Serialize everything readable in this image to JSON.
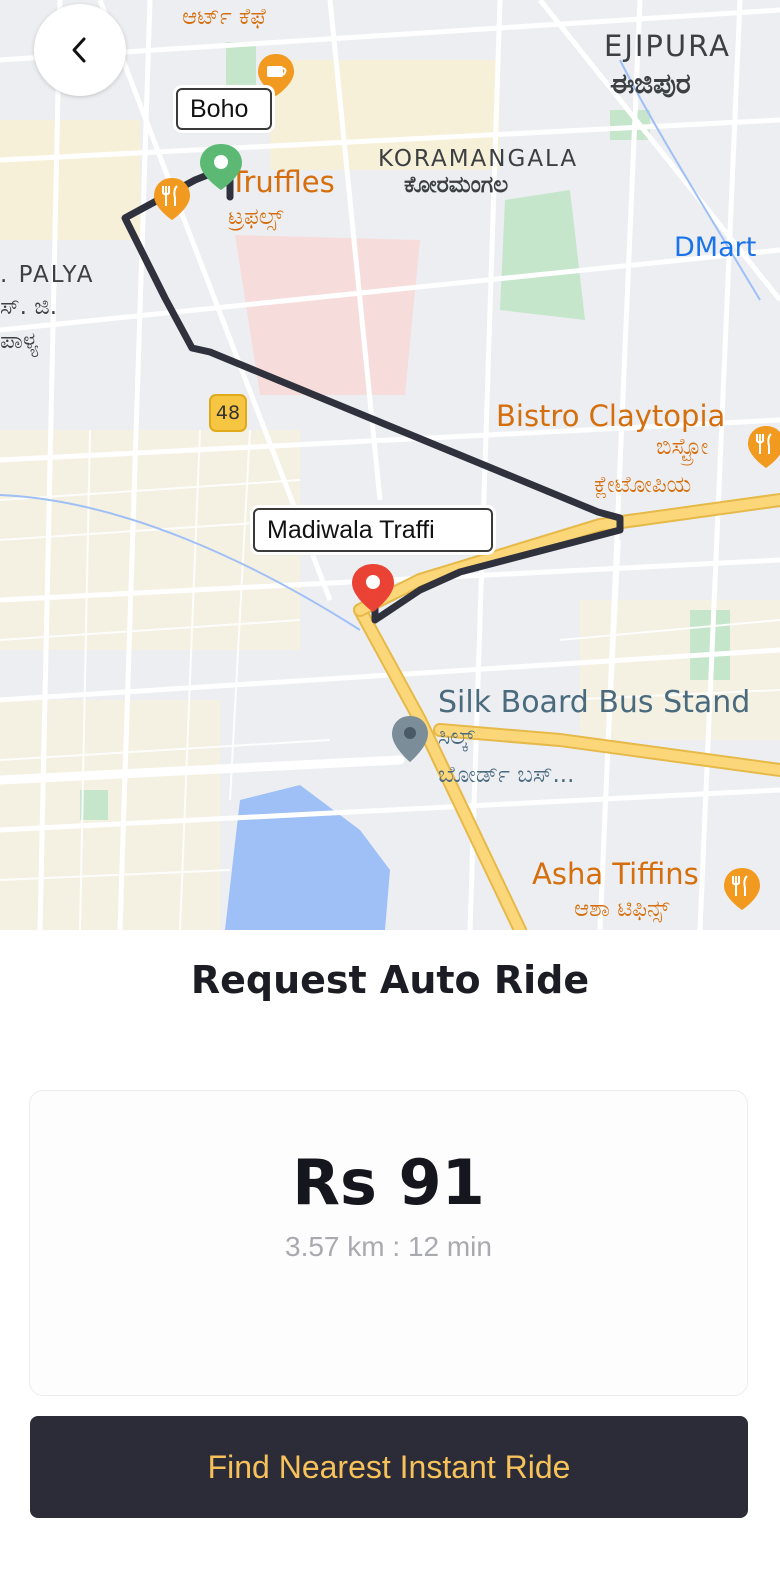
{
  "map": {
    "labels": {
      "art_cafe_kn": "ಆರ್ಟ್ ಕೆಫೆ",
      "ejipura": "EJIPURA",
      "ejipura_kn": "ಈಜಿಪುರ",
      "koramangala": "KORAMANGALA",
      "koramangala_kn": "ಕೋರಮಂಗಲ",
      "truffles": "Truffles",
      "truffles_kn": "ಟ್ರಫಲ್ಸ್",
      "palya": ". PALYA",
      "palya_kn_1": "ಸ್. ಜಿ.",
      "palya_kn_2": "ಪಾಳ್ಯ",
      "dmart": "DMart",
      "bistro": "Bistro Claytopia",
      "bistro_kn_1": "ಬಿಸ್ಟ್ರೋ",
      "bistro_kn_2": "ಕ್ಲೇಟೋಪಿಯ",
      "silk_board": "Silk Board Bus Stand",
      "silk_board_kn_1": "ಸಿಲ್ಕ್",
      "silk_board_kn_2": "ಬೋರ್ಡ್ ಬಸ್...",
      "asha": "Asha Tiffins",
      "asha_kn": "ಆಶಾ ಟಿಫಿನ್ಸ್",
      "route_shield": "48"
    },
    "pickup_label": "Boho",
    "drop_label": "Madiwala Traffi",
    "colors": {
      "route": "#2f313d",
      "pickup_pin": "#5bb974",
      "drop_pin": "#ea4335",
      "major_road": "#fcd77a",
      "water": "#9fbff7",
      "park": "#c6e6cc"
    }
  },
  "back_icon": "chevron-left-icon",
  "title": "Request Auto Ride",
  "fare": {
    "amount": "Rs 91",
    "details": "3.57 km : 12 min"
  },
  "cta_label": "Find Nearest Instant Ride",
  "accent_color": "#f7c25a"
}
